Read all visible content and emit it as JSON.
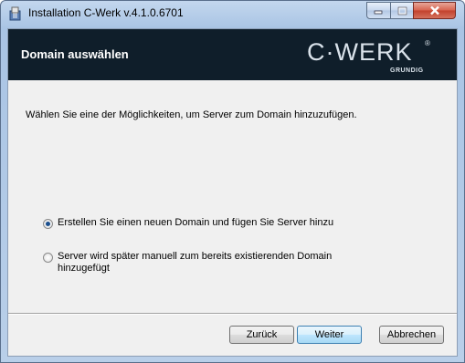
{
  "window": {
    "title": "Installation C-Werk v.4.1.0.6701",
    "icons": {
      "app": "installer-icon",
      "minimize": "minimize-icon",
      "maximize": "maximize-icon",
      "close": "close-icon"
    }
  },
  "banner": {
    "title": "Domain auswählen",
    "logo": {
      "text": "C·WERK",
      "registered": "®",
      "sub": "GRUNDIG"
    }
  },
  "content": {
    "instruction": "Wählen Sie eine der Möglichkeiten, um Server zum Domain hinzuzufügen.",
    "options": [
      {
        "label": "Erstellen Sie einen neuen Domain und fügen Sie Server hinzu",
        "selected": true
      },
      {
        "label": "Server wird später manuell zum bereits existierenden Domain hinzugefügt",
        "selected": false
      }
    ]
  },
  "buttons": {
    "back": "Zurück",
    "next": "Weiter",
    "cancel": "Abbrechen"
  }
}
